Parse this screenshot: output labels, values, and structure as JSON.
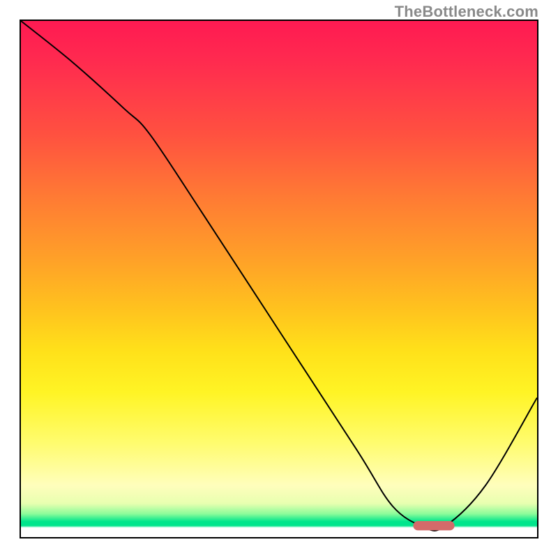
{
  "watermark": "TheBottleneck.com",
  "chart_data": {
    "type": "line",
    "title": "",
    "xlabel": "",
    "ylabel": "",
    "xlim": [
      0,
      100
    ],
    "ylim": [
      0,
      100
    ],
    "grid": false,
    "legend": false,
    "series": [
      {
        "name": "curve",
        "x": [
          0,
          10,
          20,
          25,
          35,
          50,
          65,
          72,
          78,
          82,
          90,
          100
        ],
        "values": [
          100,
          92,
          83,
          78,
          63,
          40,
          17,
          6,
          2,
          2,
          10,
          27
        ],
        "stroke": "#000000"
      }
    ],
    "marker": {
      "name": "optimal-band",
      "x_start": 76,
      "x_end": 84,
      "y": 2.2,
      "color": "#d46a6a",
      "shape": "rounded-bar"
    },
    "background_gradient": {
      "direction": "vertical",
      "stops": [
        {
          "pos": 0.0,
          "color": "#ff1a52"
        },
        {
          "pos": 0.22,
          "color": "#ff5140"
        },
        {
          "pos": 0.46,
          "color": "#ffa028"
        },
        {
          "pos": 0.64,
          "color": "#ffe11a"
        },
        {
          "pos": 0.82,
          "color": "#fffc70"
        },
        {
          "pos": 0.9,
          "color": "#fffebc"
        },
        {
          "pos": 0.955,
          "color": "#8cfc9a"
        },
        {
          "pos": 0.975,
          "color": "#00e58c"
        },
        {
          "pos": 1.0,
          "color": "#ffffff"
        }
      ]
    }
  }
}
